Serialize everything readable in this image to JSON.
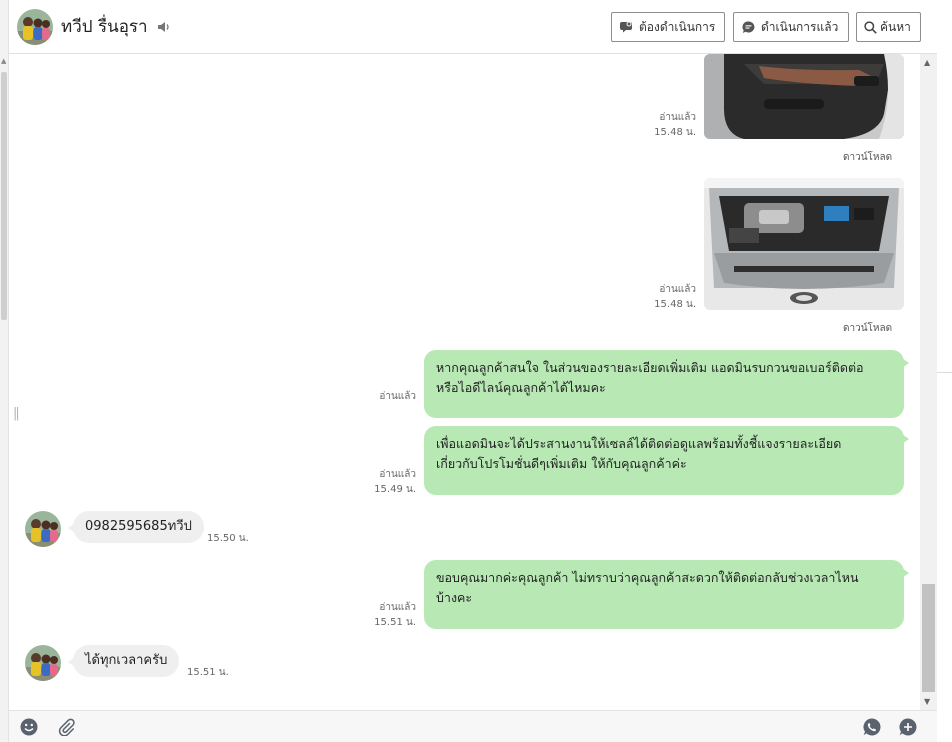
{
  "header": {
    "contact_name": "ทวีป รื่นอุรา",
    "buttons": {
      "todo": "ต้องดำเนินการ",
      "done": "ดำเนินการแล้ว",
      "search": "ค้นหา"
    }
  },
  "messages": [
    {
      "type": "image",
      "direction": "out",
      "status": "อ่านแล้ว",
      "time": "15.48 น.",
      "download": "ดาวน์โหลด",
      "subject": "car-door-interior"
    },
    {
      "type": "image",
      "direction": "out",
      "status": "อ่านแล้ว",
      "time": "15.48 น.",
      "download": "ดาวน์โหลด",
      "subject": "car-engine-bay"
    },
    {
      "type": "text",
      "direction": "out",
      "status": "อ่านแล้ว",
      "time": "",
      "lines": [
        "หากคุณลูกค้าสนใจ ในส่วนของรายละเอียดเพิ่มเติม แอดมินรบกวนขอเบอร์ติดต่อ",
        "หรือไอดีไลน์คุณลูกค้าได้ไหมคะ"
      ]
    },
    {
      "type": "text",
      "direction": "out",
      "status": "อ่านแล้ว",
      "time": "15.49 น.",
      "lines": [
        "เพื่อแอดมินจะได้ประสานงานให้เซลล์ได้ติดต่อดูแลพร้อมทั้งชี้แจงรายละเอียด",
        "เกี่ยวกับโปรโมชั่นดีๆเพิ่มเติม ให้กับคุณลูกค้าค่ะ"
      ]
    },
    {
      "type": "text",
      "direction": "in",
      "time": "15.50 น.",
      "text": "0982595685ทวีป"
    },
    {
      "type": "text",
      "direction": "out",
      "status": "อ่านแล้ว",
      "time": "15.51 น.",
      "lines": [
        "ขอบคุณมากค่ะคุณลูกค้า ไม่ทราบว่าคุณลูกค้าสะดวกให้ติดต่อกลับช่วงเวลาไหน",
        "บ้างคะ"
      ]
    },
    {
      "type": "text",
      "direction": "in",
      "time": "15.51 น.",
      "text": "ได้ทุกเวลาครับ"
    }
  ],
  "footer": {
    "icons": [
      "emoji-icon",
      "attachment-icon",
      "call-icon",
      "add-icon"
    ]
  },
  "colors": {
    "outgoing_bubble": "#b8e9b5",
    "incoming_bubble": "#efefef"
  }
}
